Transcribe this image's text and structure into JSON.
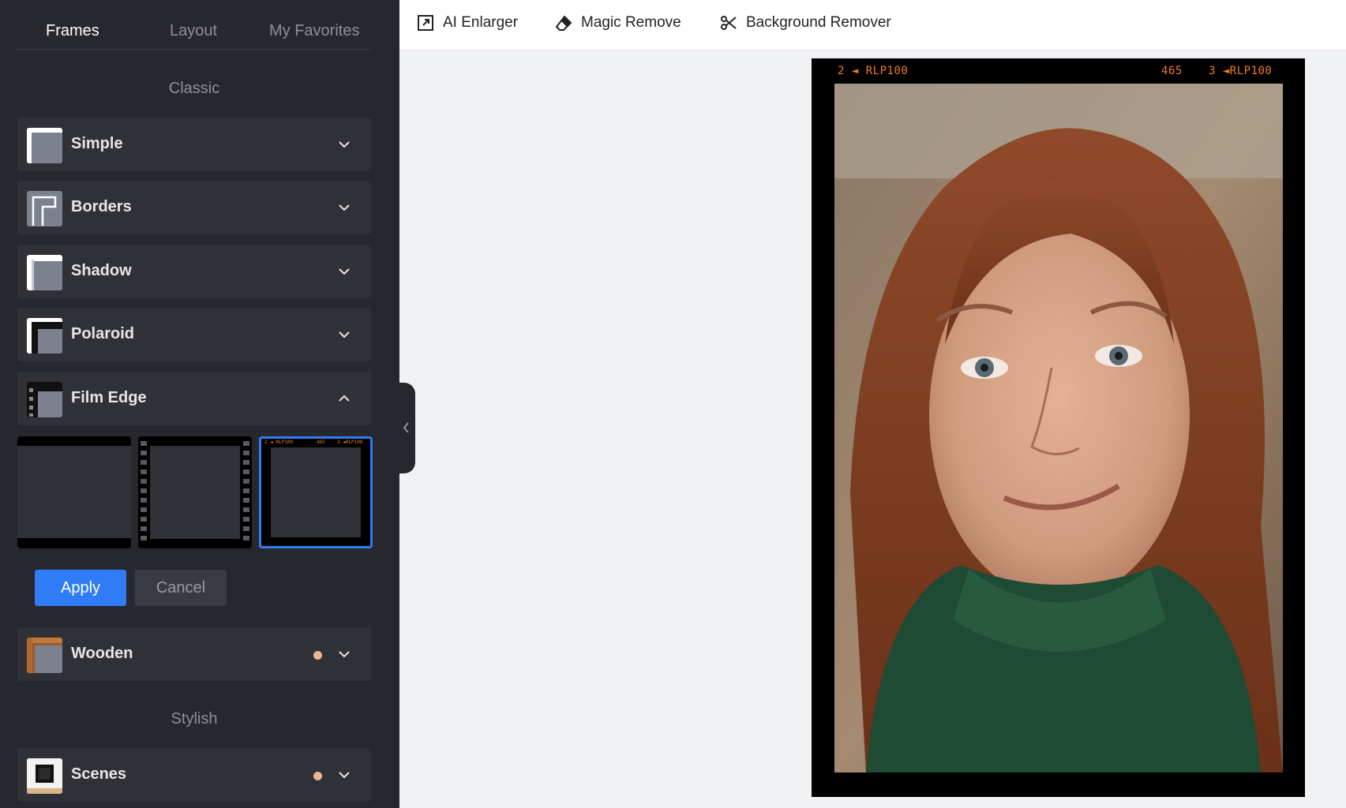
{
  "sidebar": {
    "tabs": [
      {
        "label": "Frames",
        "active": true
      },
      {
        "label": "Layout",
        "active": false
      },
      {
        "label": "My Favorites",
        "active": false
      }
    ],
    "sections": {
      "classic": "Classic",
      "stylish": "Stylish"
    },
    "frames": [
      {
        "label": "Simple",
        "expanded": false,
        "premium": false
      },
      {
        "label": "Borders",
        "expanded": false,
        "premium": false
      },
      {
        "label": "Shadow",
        "expanded": false,
        "premium": false
      },
      {
        "label": "Polaroid",
        "expanded": false,
        "premium": false
      },
      {
        "label": "Film Edge",
        "expanded": true,
        "premium": false
      },
      {
        "label": "Wooden",
        "expanded": false,
        "premium": true
      },
      {
        "label": "Scenes",
        "expanded": false,
        "premium": true
      }
    ],
    "film_edge_options": {
      "selected_index": 2,
      "mini_left": "2 ◄ RLP100",
      "mini_mid": "465",
      "mini_right": "3 ◄RLP100"
    },
    "apply_label": "Apply",
    "cancel_label": "Cancel",
    "premium_dot_color": "#e9b893",
    "accent_color": "#2f7cf6"
  },
  "toolbar": {
    "tools": [
      {
        "label": "AI Enlarger",
        "icon": "enlarge-icon"
      },
      {
        "label": "Magic Remove",
        "icon": "eraser-icon"
      },
      {
        "label": "Background Remover",
        "icon": "scissors-icon"
      }
    ]
  },
  "canvas": {
    "film_left": "2 ◄ RLP100",
    "film_mid": "465",
    "film_right": "3 ◄RLP100",
    "film_text_color": "#f07d1a"
  }
}
